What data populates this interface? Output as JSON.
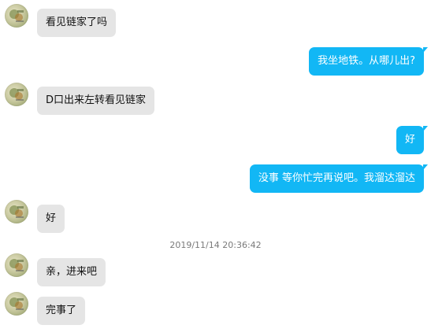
{
  "messages": [
    {
      "side": "in",
      "text": "看见链家了吗"
    },
    {
      "side": "out",
      "text": "我坐地铁。从哪儿出?"
    },
    {
      "side": "in",
      "text": "D口出来左转看见链家"
    },
    {
      "side": "out",
      "text": "好"
    },
    {
      "side": "out",
      "text": "没事 等你忙完再说吧。我溜达溜达"
    },
    {
      "side": "in",
      "text": "好"
    },
    {
      "side": "in",
      "text": "亲，进来吧"
    },
    {
      "side": "in",
      "text": "完事了"
    }
  ],
  "timestamp": "2019/11/14 20:36:42",
  "colors": {
    "incoming_bubble": "#e5e5e5",
    "outgoing_bubble": "#12b7f5",
    "timestamp_text": "#7a7a7a"
  },
  "icons": {
    "avatar": "user-avatar-icon"
  }
}
